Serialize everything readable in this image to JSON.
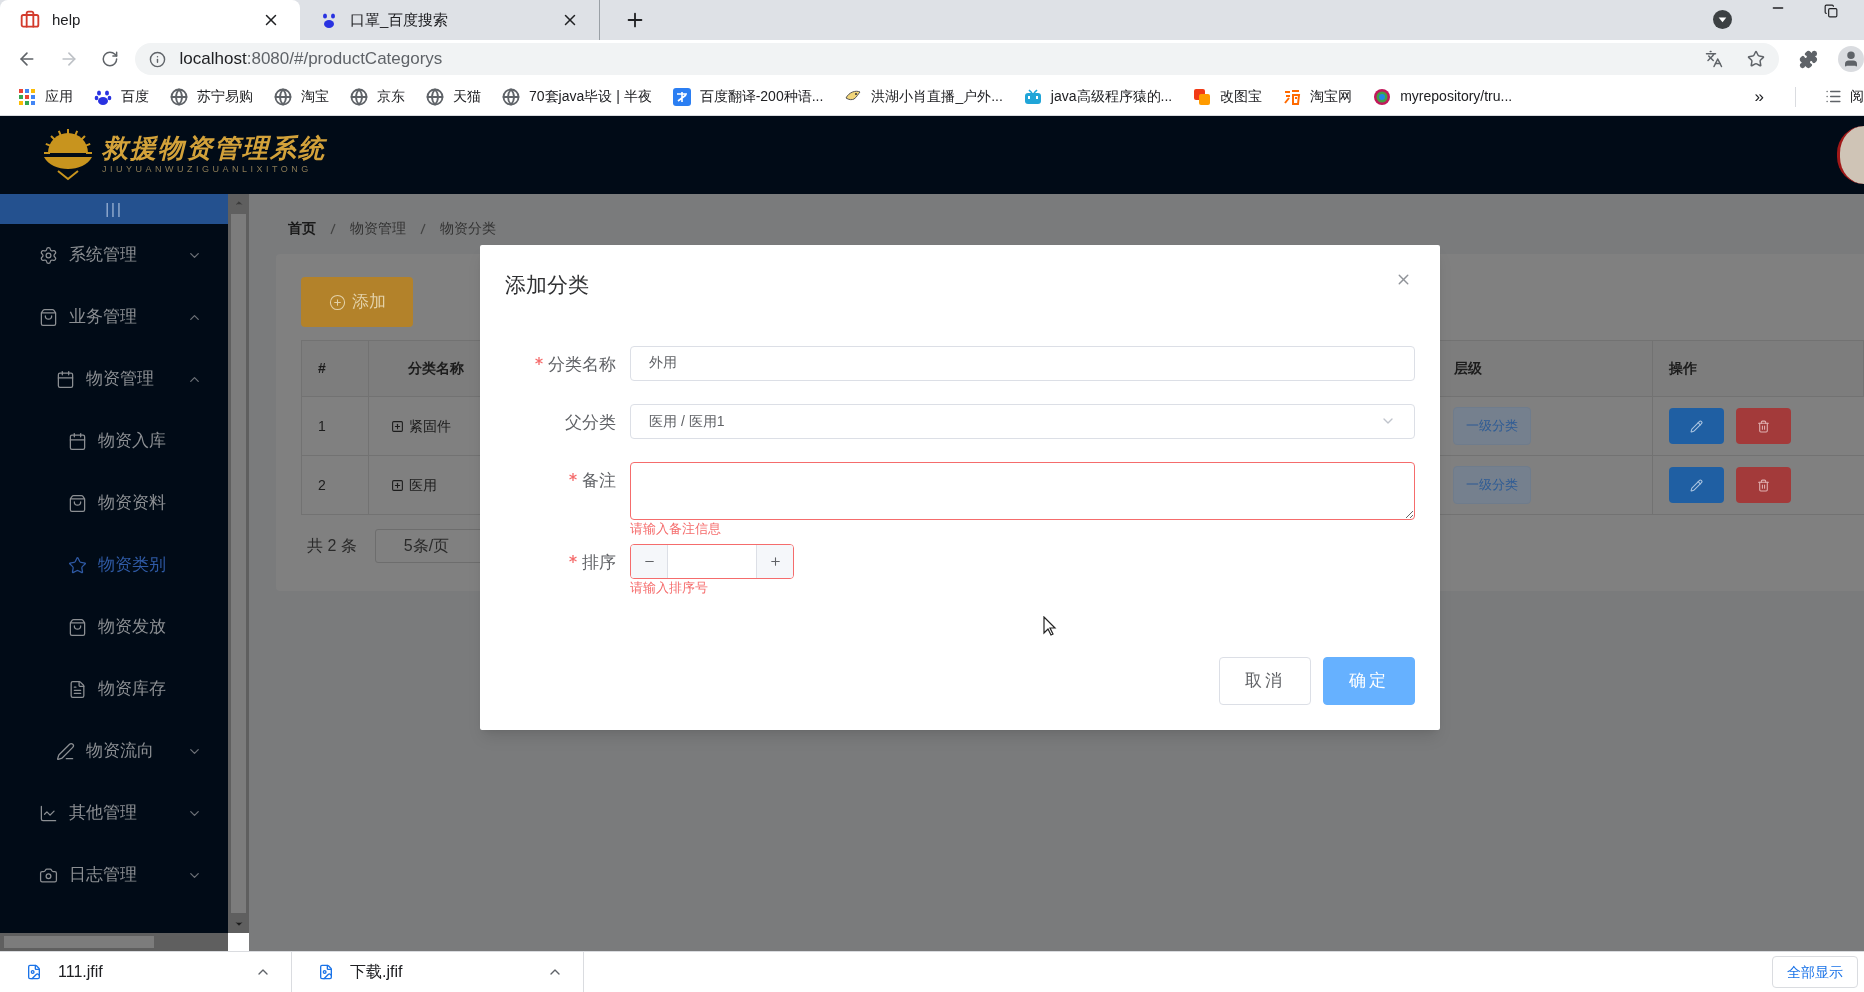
{
  "browser": {
    "tabs": [
      {
        "title": "help",
        "selected": true
      },
      {
        "title": "口罩_百度搜索",
        "selected": false
      }
    ],
    "address": {
      "host": "localhost",
      "path": ":8080/#/productCategorys"
    },
    "bookmarks": [
      {
        "label": "应用"
      },
      {
        "label": "百度"
      },
      {
        "label": "苏宁易购"
      },
      {
        "label": "淘宝"
      },
      {
        "label": "京东"
      },
      {
        "label": "天猫"
      },
      {
        "label": "70套java毕设 | 半夜"
      },
      {
        "label": "百度翻译-200种语..."
      },
      {
        "label": "洪湖小肖直播_户外..."
      },
      {
        "label": "java高级程序猿的..."
      },
      {
        "label": "改图宝"
      },
      {
        "label": "淘宝网"
      },
      {
        "label": "myrepository/tru..."
      }
    ],
    "bookmarks_more": "»",
    "reading_list": "阅"
  },
  "app": {
    "logo": {
      "title": "救援物资管理系统",
      "subtitle": "JIUYUANWUZIGUANLIXITONG"
    },
    "sidebar": {
      "toggle": "|||",
      "menu": [
        {
          "label": "系统管理",
          "expanded": false,
          "selected": false
        },
        {
          "label": "业务管理",
          "expanded": true,
          "selected": false,
          "children": [
            {
              "label": "物资管理",
              "expanded": true,
              "selected": false,
              "children": [
                {
                  "label": "物资入库",
                  "selected": false
                },
                {
                  "label": "物资资料",
                  "selected": false
                },
                {
                  "label": "物资类别",
                  "selected": true
                },
                {
                  "label": "物资发放",
                  "selected": false
                },
                {
                  "label": "物资库存",
                  "selected": false
                }
              ]
            },
            {
              "label": "物资流向",
              "expanded": false,
              "selected": false
            }
          ]
        },
        {
          "label": "其他管理",
          "expanded": false,
          "selected": false
        },
        {
          "label": "日志管理",
          "expanded": false,
          "selected": false
        }
      ]
    },
    "breadcrumb": [
      "首页",
      "物资管理",
      "物资分类"
    ],
    "add_button": "添加",
    "table": {
      "columns": [
        "#",
        "分类名称",
        "层级",
        "操作"
      ],
      "rows": [
        {
          "index": "1",
          "name": "紧固件",
          "expanded": false,
          "level": "一级分类"
        },
        {
          "index": "2",
          "name": "医用",
          "expanded": false,
          "level": "一级分类"
        }
      ]
    },
    "pagination": {
      "total": "共 2 条",
      "page_size": "5条/页"
    },
    "dialog": {
      "title": "添加分类",
      "fields": [
        {
          "kind": "text",
          "label": "分类名称",
          "required": true,
          "value": "外用"
        },
        {
          "kind": "select",
          "label": "父分类",
          "required": false,
          "value": "医用 / 医用1"
        },
        {
          "kind": "textarea",
          "label": "备注",
          "required": true,
          "error": "请输入备注信息"
        },
        {
          "kind": "number",
          "label": "排序",
          "required": true,
          "error": "请输入排序号"
        }
      ],
      "buttons": [
        {
          "kind": "default",
          "label": "取消"
        },
        {
          "kind": "primary",
          "label": "确定"
        }
      ]
    }
  },
  "downloads": {
    "files": [
      {
        "name": "111.jfif"
      },
      {
        "name": "下载.jfif"
      }
    ],
    "show_all": "全部显示"
  }
}
